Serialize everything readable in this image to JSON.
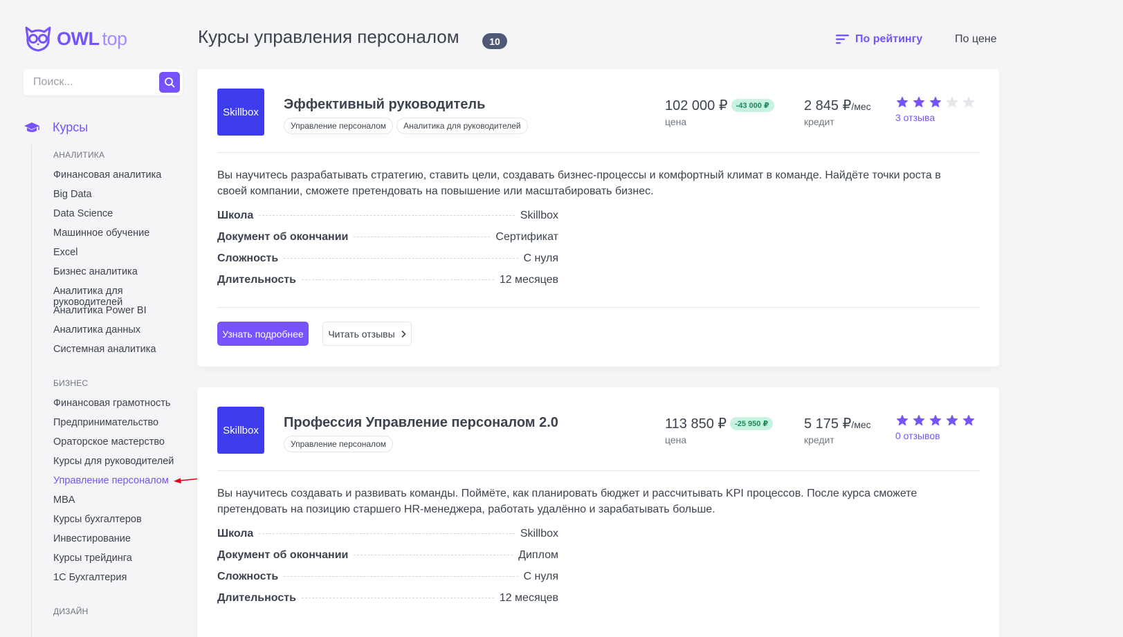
{
  "brand": {
    "name": "OWL",
    "suffix": "top"
  },
  "search": {
    "placeholder": "Поиск..."
  },
  "menu": {
    "title": "Курсы",
    "categories": [
      {
        "title": "Аналитика",
        "items": [
          "Финансовая аналитика",
          "Big Data",
          "Data Science",
          "Машинное обучение",
          "Excel",
          "Бизнес аналитика",
          "Аналитика для руководителей",
          "Аналитика Power BI",
          "Аналитика данных",
          "Системная аналитика"
        ]
      },
      {
        "title": "Бизнес",
        "items": [
          "Финансовая грамотность",
          "Предпринимательство",
          "Ораторское мастерство",
          "Курсы для руководителей",
          "Управление персоналом",
          "MBA",
          "Курсы бухгалтеров",
          "Инвестирование",
          "Курсы трейдинга",
          "1С Бухгалтерия"
        ]
      },
      {
        "title": "Дизайн",
        "items": []
      }
    ],
    "active_item": "Управление персоналом"
  },
  "header": {
    "title": "Курсы управления персоналом",
    "count": "10",
    "sort_rating": "По рейтингу",
    "sort_price": "По цене"
  },
  "colors": {
    "accent": "#7653fc",
    "school_logo": "#3d3ded",
    "discount_bg": "#c7f2df",
    "discount_text": "#1c8a57",
    "arrow": "#e0001a"
  },
  "courses": [
    {
      "logo": "Skillbox",
      "title": "Эффективный руководитель",
      "tags": [
        "Управление персоналом",
        "Аналитика для руководителей"
      ],
      "price": "102 000 ₽",
      "discount": "-43 000 ₽",
      "price_label": "цена",
      "credit": "2 845 ₽",
      "credit_unit": "/мес",
      "credit_label": "кредит",
      "rating": 3,
      "rating_max": 5,
      "reviews": "3 отзыва",
      "description": "Вы научитесь разрабатывать стратегию, ставить цели, создавать бизнес-процессы и комфортный климат в команде. Найдёте точки роста в своей компании, сможете претендовать на повышение или масштабировать бизнес.",
      "features": [
        {
          "name": "Школа",
          "value": "Skillbox"
        },
        {
          "name": "Документ об окончании",
          "value": "Сертификат"
        },
        {
          "name": "Сложность",
          "value": "С нуля"
        },
        {
          "name": "Длительность",
          "value": "12 месяцев"
        }
      ],
      "more_button": "Узнать подробнее",
      "reviews_button": "Читать отзывы"
    },
    {
      "logo": "Skillbox",
      "title": "Профессия Управление персоналом 2.0",
      "tags": [
        "Управление персоналом"
      ],
      "price": "113 850 ₽",
      "discount": "-25 950 ₽",
      "price_label": "цена",
      "credit": "5 175 ₽",
      "credit_unit": "/мес",
      "credit_label": "кредит",
      "rating": 5,
      "rating_max": 5,
      "reviews": "0 отзывов",
      "description": "Вы научитесь создавать и развивать команды. Поймёте, как планировать бюджет и рассчитывать KPI процессов. После курса сможете претендовать на позицию старшего HR-менеджера, работать удалённо и зарабатывать больше.",
      "features": [
        {
          "name": "Школа",
          "value": "Skillbox"
        },
        {
          "name": "Документ об окончании",
          "value": "Диплом"
        },
        {
          "name": "Сложность",
          "value": "С нуля"
        },
        {
          "name": "Длительность",
          "value": "12 месяцев"
        }
      ]
    }
  ]
}
